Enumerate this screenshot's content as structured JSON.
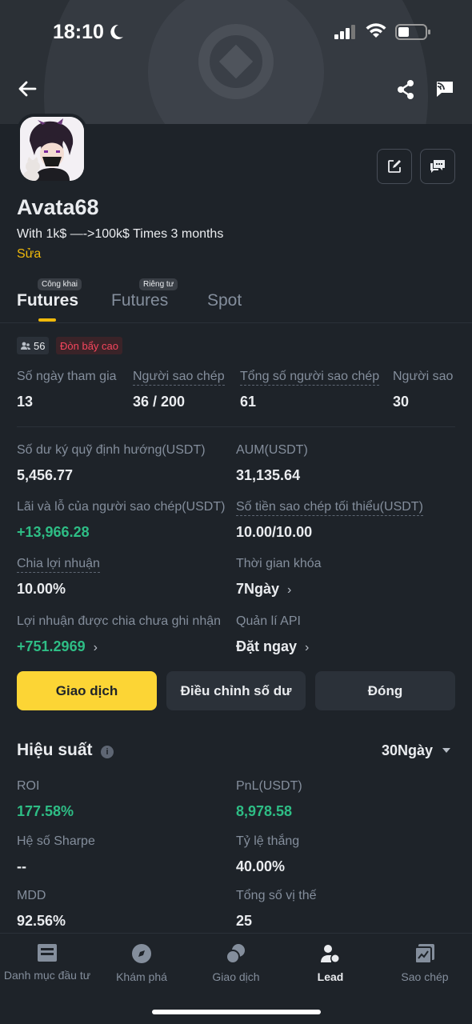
{
  "status_bar": {
    "time": "18:10"
  },
  "profile": {
    "name": "Avata68",
    "bio": "With 1k$ —->100k$ Times 3 months",
    "edit_label": "Sửa"
  },
  "tabs": [
    {
      "label": "Futures",
      "badge": "Công khai",
      "active": true
    },
    {
      "label": "Futures",
      "badge": "Riêng tư",
      "active": false
    },
    {
      "label": "Spot",
      "badge": "",
      "active": false
    }
  ],
  "tags": {
    "followers": "56",
    "risk": "Đòn bẩy cao"
  },
  "summary": [
    {
      "label": "Số ngày tham gia",
      "value": "13"
    },
    {
      "label": "Người sao chép",
      "value": "36 / 200"
    },
    {
      "label": "Tổng số người sao chép",
      "value": "61"
    },
    {
      "label": "Người sao",
      "value": "30"
    }
  ],
  "details": {
    "margin_balance": {
      "label": "Số dư ký quỹ định hướng(USDT)",
      "value": "5,456.77"
    },
    "aum": {
      "label": "AUM(USDT)",
      "value": "31,135.64"
    },
    "copier_pnl": {
      "label": "Lãi và lỗ của người sao chép(USDT)",
      "value": "+13,966.28"
    },
    "min_copy": {
      "label": "Số tiền sao chép tối thiểu(USDT)",
      "value": "10.00/10.00"
    },
    "profit_share": {
      "label": "Chia lợi nhuận",
      "value": "10.00%"
    },
    "lock_time": {
      "label": "Thời gian khóa",
      "value": "7Ngày"
    },
    "unrealized_share": {
      "label": "Lợi nhuận được chia chưa ghi nhận",
      "value": "+751.2969"
    },
    "api": {
      "label": "Quản lí API",
      "value": "Đặt ngay"
    }
  },
  "actions": {
    "trade": "Giao dịch",
    "adjust": "Điều chỉnh số dư",
    "close": "Đóng"
  },
  "performance": {
    "title": "Hiệu suất",
    "period": "30Ngày",
    "roi": {
      "label": "ROI",
      "value": "177.58%"
    },
    "pnl": {
      "label": "PnL(USDT)",
      "value": "8,978.58"
    },
    "sharpe": {
      "label": "Hệ số Sharpe",
      "value": "--"
    },
    "win_rate": {
      "label": "Tỷ lệ thắng",
      "value": "40.00%"
    },
    "mdd": {
      "label": "MDD",
      "value": "92.56%"
    },
    "positions": {
      "label": "Tổng số vị thế",
      "value": "25"
    }
  },
  "nav": [
    {
      "label": "Danh mục đầu tư",
      "icon": "portfolio-icon"
    },
    {
      "label": "Khám phá",
      "icon": "compass-icon"
    },
    {
      "label": "Giao dịch",
      "icon": "trade-icon"
    },
    {
      "label": "Lead",
      "icon": "lead-icon",
      "active": true
    },
    {
      "label": "Sao chép",
      "icon": "copy-chart-icon"
    }
  ],
  "colors": {
    "accent": "#fcd535",
    "positive": "#2ebd85",
    "negative": "#f6465d",
    "background": "#1e2329"
  }
}
